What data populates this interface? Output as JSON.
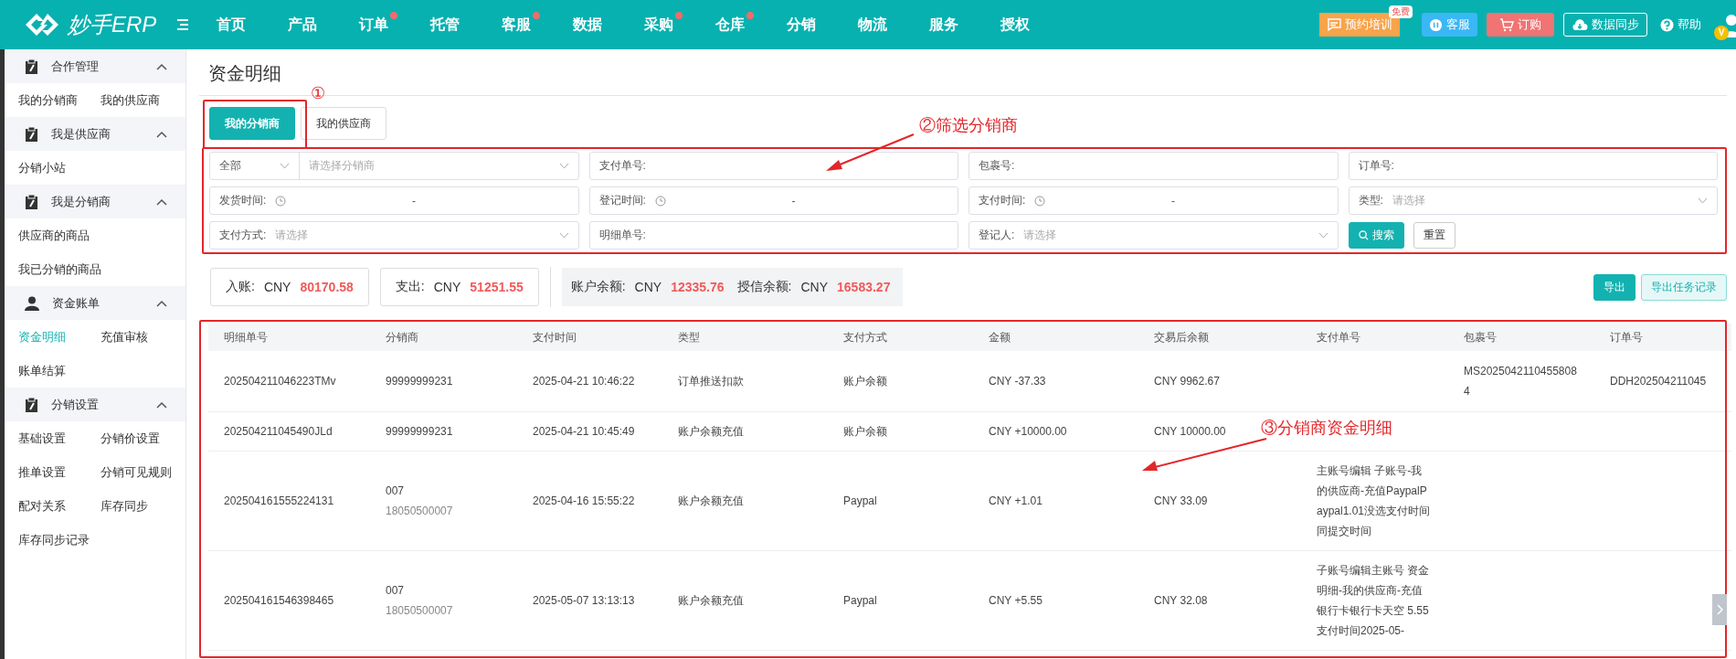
{
  "topbar": {
    "logo": "妙手ERP",
    "nav": [
      {
        "label": "首页",
        "dot": false
      },
      {
        "label": "产品",
        "dot": false
      },
      {
        "label": "订单",
        "dot": true
      },
      {
        "label": "托管",
        "dot": false
      },
      {
        "label": "客服",
        "dot": true
      },
      {
        "label": "数据",
        "dot": false
      },
      {
        "label": "采购",
        "dot": true
      },
      {
        "label": "仓库",
        "dot": true
      },
      {
        "label": "分销",
        "dot": false
      },
      {
        "label": "物流",
        "dot": false
      },
      {
        "label": "服务",
        "dot": false
      },
      {
        "label": "授权",
        "dot": false
      }
    ],
    "actions": [
      {
        "kind": "training",
        "label": "预约培训",
        "badge": "免费"
      },
      {
        "kind": "service",
        "label": "客服"
      },
      {
        "kind": "order",
        "label": "订购"
      },
      {
        "kind": "sync",
        "label": "数据同步"
      },
      {
        "kind": "help",
        "label": "帮助"
      }
    ],
    "avatar_badge": "V"
  },
  "sidebar": [
    {
      "title": "合作管理",
      "expanded": true,
      "items": [
        {
          "label": "我的分销商",
          "selected": false
        },
        {
          "label": "我的供应商",
          "selected": false
        }
      ]
    },
    {
      "title": "我是供应商",
      "expanded": true,
      "items": [
        {
          "label": "分销小站",
          "selected": false
        }
      ]
    },
    {
      "title": "我是分销商",
      "expanded": true,
      "items": [
        {
          "label": "供应商的商品",
          "selected": false
        },
        {
          "label": "我已分销的商品",
          "selected": false
        }
      ]
    },
    {
      "title": "资金账单",
      "expanded": true,
      "items": [
        {
          "label": "资金明细",
          "selected": true
        },
        {
          "label": "充值审核",
          "selected": false
        },
        {
          "label": "账单结算",
          "selected": false
        }
      ]
    },
    {
      "title": "分销设置",
      "expanded": true,
      "items": [
        {
          "label": "基础设置",
          "selected": false
        },
        {
          "label": "分销价设置",
          "selected": false
        },
        {
          "label": "推单设置",
          "selected": false
        },
        {
          "label": "分销可见规则",
          "selected": false
        },
        {
          "label": "配对关系",
          "selected": false
        },
        {
          "label": "库存同步",
          "selected": false
        },
        {
          "label": "库存同步记录",
          "selected": false
        }
      ]
    }
  ],
  "page_title": "资金明细",
  "tabs": [
    {
      "label": "我的分销商",
      "selected": true
    },
    {
      "label": "我的供应商",
      "selected": false
    }
  ],
  "filters": [
    {
      "kind": "combo",
      "value": "全部",
      "placeholder": "请选择分销商"
    },
    {
      "kind": "text",
      "label": "支付单号:"
    },
    {
      "kind": "text",
      "label": "包裹号:"
    },
    {
      "kind": "text",
      "label": "订单号:"
    },
    {
      "kind": "daterange",
      "label": "发货时间:",
      "separator": "-"
    },
    {
      "kind": "daterange",
      "label": "登记时间:",
      "separator": "-"
    },
    {
      "kind": "daterange",
      "label": "支付时间:",
      "separator": "-"
    },
    {
      "kind": "select",
      "label": "类型:",
      "placeholder": "请选择"
    },
    {
      "kind": "select",
      "label": "支付方式:",
      "placeholder": "请选择"
    },
    {
      "kind": "text",
      "label": "明细单号:"
    },
    {
      "kind": "select",
      "label": "登记人:",
      "placeholder": "请选择"
    }
  ],
  "filter_buttons": [
    {
      "kind": "primary",
      "label": "搜索"
    },
    {
      "kind": "plain",
      "label": "重置"
    }
  ],
  "summary": [
    {
      "label": "入账:",
      "currency": "CNY",
      "value": "80170.58"
    },
    {
      "label": "支出:",
      "currency": "CNY",
      "value": "51251.55"
    },
    {
      "label": "账户余额:",
      "currency": "CNY",
      "value": "12335.76"
    },
    {
      "label": "授信余额:",
      "currency": "CNY",
      "value": "16583.27"
    }
  ],
  "export_buttons": [
    {
      "kind": "primary",
      "label": "导出"
    },
    {
      "kind": "outline",
      "label": "导出任务记录"
    }
  ],
  "table": {
    "columns": [
      "明细单号",
      "分销商",
      "支付时间",
      "类型",
      "支付方式",
      "金额",
      "交易后余额",
      "支付单号",
      "包裹号",
      "订单号"
    ],
    "rows": [
      {
        "id": "202504211046223TMv",
        "distributor": "99999999231",
        "distributor_sub": "",
        "time": "2025-04-21 10:46:22",
        "type": "订单推送扣款",
        "method": "账户余额",
        "amount": "CNY -37.33",
        "balance": "CNY 9962.67",
        "pay_no": "",
        "package": "MS20250421104558084",
        "order": "DDH202504211045"
      },
      {
        "id": "202504211045490JLd",
        "distributor": "99999999231",
        "distributor_sub": "",
        "time": "2025-04-21 10:45:49",
        "type": "账户余额充值",
        "method": "账户余额",
        "amount": "CNY +10000.00",
        "balance": "CNY 10000.00",
        "pay_no": "",
        "package": "",
        "order": ""
      },
      {
        "id": "202504161555224131",
        "distributor": "007",
        "distributor_sub": "18050500007",
        "time": "2025-04-16 15:55:22",
        "type": "账户余额充值",
        "method": "Paypal",
        "amount": "CNY +1.01",
        "balance": "CNY 33.09",
        "pay_no": "主账号编辑 子账号-我的供应商-充值PaypalPaypal1.01没选支付时间同提交时间",
        "package": "",
        "order": ""
      },
      {
        "id": "202504161546398465",
        "distributor": "007",
        "distributor_sub": "18050500007",
        "time": "2025-05-07 13:13:13",
        "type": "账户余额充值",
        "method": "Paypal",
        "amount": "CNY +5.55",
        "balance": "CNY 32.08",
        "pay_no": "子账号编辑主账号 资金明细-我的供应商-充值银行卡银行卡天空 5.55支付时间2025-05-",
        "package": "",
        "order": ""
      }
    ]
  },
  "annotations": [
    {
      "label": "①"
    },
    {
      "label": "②筛选分销商"
    },
    {
      "label": "③分销商资金明细"
    }
  ]
}
